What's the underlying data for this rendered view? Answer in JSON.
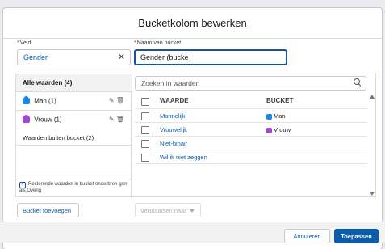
{
  "modal": {
    "title": "Bucketkolom bewerken"
  },
  "fields": {
    "veld_label": "Veld",
    "veld_value": "Gender",
    "name_label": "Naam van bucket",
    "name_value": "Gender (bucke"
  },
  "left": {
    "header": "Alle waarden (4)",
    "buckets": [
      {
        "label": "Man (1)",
        "color": "#1589ee"
      },
      {
        "label": "Vrouw (1)",
        "color": "#a145d6"
      }
    ],
    "outside": "Waarden buiten bucket (2)",
    "remaining_checkbox_label": "Resterende waarden in bucket onderbren-gen als Overig"
  },
  "right": {
    "search_placeholder": "Zoeken in waarden",
    "columns": {
      "value": "WAARDE",
      "bucket": "BUCKET"
    },
    "rows": [
      {
        "value": "Mannelijk",
        "bucket": "Man",
        "bucket_color": "#1589ee"
      },
      {
        "value": "Vrouwelijk",
        "bucket": "Vrouw",
        "bucket_color": "#a145d6"
      },
      {
        "value": "Niet-binair",
        "bucket": "",
        "bucket_color": ""
      },
      {
        "value": "Wil ik niet zeggen",
        "bucket": "",
        "bucket_color": ""
      }
    ]
  },
  "buttons": {
    "add_bucket": "Bucket toevoegen",
    "move_to": "Verplaatsen naar",
    "cancel": "Annuleren",
    "apply": "Toepassen"
  },
  "colors": {
    "brand_blue": "#0b5cab",
    "required_red": "#c23934"
  }
}
